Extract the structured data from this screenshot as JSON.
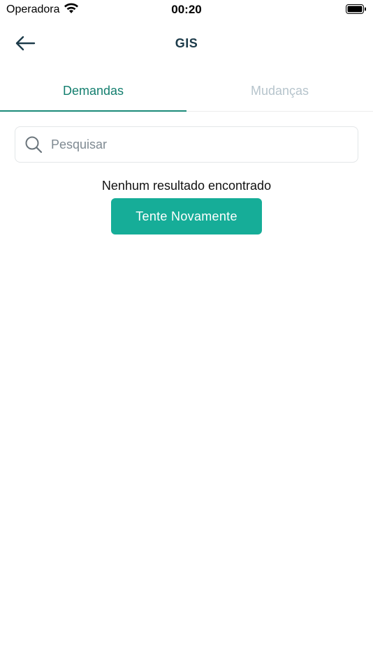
{
  "status_bar": {
    "carrier": "Operadora",
    "time": "00:20",
    "wifi_icon": "wifi-icon",
    "battery_icon": "battery-icon"
  },
  "nav": {
    "back_icon": "arrow-left-icon",
    "title": "GIS"
  },
  "tabs": [
    {
      "label": "Demandas",
      "active": true
    },
    {
      "label": "Mudanças",
      "active": false
    }
  ],
  "search": {
    "icon": "search-icon",
    "placeholder": "Pesquisar",
    "value": ""
  },
  "empty_state": {
    "message": "Nenhum resultado encontrado",
    "retry_label": "Tente Novamente"
  },
  "colors": {
    "accent": "#16ad98",
    "active_tab": "#147f6f",
    "inactive_tab": "#b6c4cc",
    "title": "#1d3b4a"
  }
}
